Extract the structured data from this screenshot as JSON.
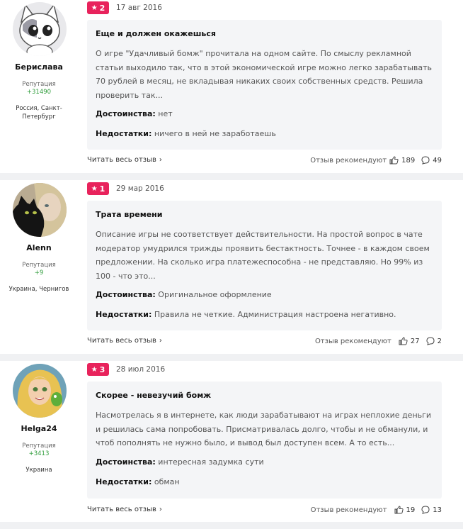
{
  "reviews": [
    {
      "user": {
        "name": "Берислава",
        "rep_label": "Репутация",
        "rep_value": "+31490",
        "city": "Россия, Санкт-Петербург"
      },
      "rating": "2",
      "date": "17 авг 2016",
      "title": "Еще и должен окажешься",
      "body": "О игре \"Удачливый бомж\" прочитала на одном сайте. По смыслу рекламной статьи выходило так, что в этой экономической игре можно легко зарабатывать 70 рублей в месяц, не вкладывая никаких своих собственных средств. Решила проверить так...",
      "pros_label": "Достоинства:",
      "pros": "нет",
      "cons_label": "Недостатки:",
      "cons": "ничего в ней не заработаешь",
      "read_more": "Читать весь отзыв",
      "recommend_label": "Отзыв рекомендуют",
      "likes": "189",
      "comments": "49"
    },
    {
      "user": {
        "name": "Alenn",
        "rep_label": "Репутация",
        "rep_value": "+9",
        "city": "Украина, Чернигов"
      },
      "rating": "1",
      "date": "29 мар 2016",
      "title": "Трата времени",
      "body": "Описание игры не соответствует действительности. На простой вопрос в чате модератор умудрился трижды проявить бестактность. Точнее - в каждом своем предложении. На сколько игра платежеспособна - не представляю. Но 99% из 100 - что это...",
      "pros_label": "Достоинства:",
      "pros": "Оригинальное оформление",
      "cons_label": "Недостатки:",
      "cons": "Правила не четкие. Администрация настроена негативно.",
      "read_more": "Читать весь отзыв",
      "recommend_label": "Отзыв рекомендуют",
      "likes": "27",
      "comments": "2"
    },
    {
      "user": {
        "name": "Helga24",
        "rep_label": "Репутация",
        "rep_value": "+3413",
        "city": "Украина"
      },
      "rating": "3",
      "date": "28 июл 2016",
      "title": "Скорее - невезучий бомж",
      "body": "Насмотрелась я в интернете, как люди зарабатывают на играх неплохие деньги и решилась сама попробовать. Присматривалась долго, чтобы и не обманули, и чтоб пополнять не нужно было, и вывод был доступен всем. А то есть...",
      "pros_label": "Достоинства:",
      "pros": "интересная задумка сути",
      "cons_label": "Недостатки:",
      "cons": "обман",
      "read_more": "Читать весь отзыв",
      "recommend_label": "Отзыв рекомендуют",
      "likes": "19",
      "comments": "13"
    }
  ],
  "colors": {
    "badge": "#e8235c",
    "reputation": "#2e9c3a",
    "card_bg": "#f4f5f7",
    "separator": "#f0f1f3"
  },
  "icons": {
    "star": "star-icon",
    "chevron": "chevron-right-icon",
    "like": "thumbs-up-icon",
    "comment": "comment-icon"
  }
}
